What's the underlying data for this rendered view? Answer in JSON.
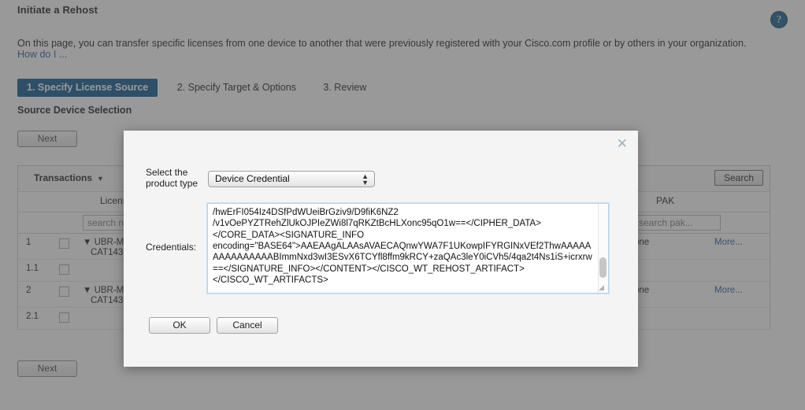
{
  "page": {
    "title": "Initiate a Rehost",
    "intro": "On this page, you can transfer specific licenses from one device to another that were previously registered with your Cisco.com profile or by others in your organization.",
    "how_do_i": "How do I ...",
    "help_icon": "question-mark-icon",
    "section_title": "Source Device Selection",
    "next_label": "Next",
    "steps": [
      {
        "label": "1. Specify License Source",
        "active": true
      },
      {
        "label": "2. Specify Target & Options",
        "active": false
      },
      {
        "label": "3. Review",
        "active": false
      }
    ]
  },
  "grid": {
    "transactions_label": "Transactions",
    "transactions_caret": "▼",
    "search_button": "Search",
    "columns": {
      "license": "License",
      "pak": "PAK"
    },
    "filters": {
      "license_placeholder": "search n",
      "pak_placeholder": "search pak..."
    },
    "rows": [
      {
        "num": "1",
        "device_line1": "▼ UBR-M(",
        "device_line2": "CAT143",
        "pak": "one",
        "more": "More..."
      },
      {
        "num": "1.1",
        "device_line1": "",
        "device_line2": "",
        "pak": "",
        "more": ""
      },
      {
        "num": "2",
        "device_line1": "▼ UBR-M(",
        "device_line2": "CAT143",
        "pak": "one",
        "more": "More..."
      },
      {
        "num": "2.1",
        "device_line1": "",
        "device_line2": "",
        "pak": "",
        "more": ""
      }
    ]
  },
  "modal": {
    "close_icon": "close-x-icon",
    "product_type_label": "Select the product type",
    "product_type_value": "Device Credential",
    "credentials_label": "Credentials:",
    "credentials_value": "/hwErFI054Iz4DSfPdWUeiBrGziv9/D9fiK6NZ2\n/v1vOePYZTRehZlUkOJPIeZWi8l7qRKZtBcHLXonc95qO1w==</CIPHER_DATA>\n</CORE_DATA><SIGNATURE_INFO\nencoding=\"BASE64\">AAEAAgALAAsAVAECAQnwYWA7F1UKowpIFYRGINxVEf2ThwAAAAAAAAAAAAAAABImmNxd3wI3ESvX6TCYfl8ffm9kRCY+zaQAc3leY0iCVh5/4qa2t4Ns1iS+icrxrw==</SIGNATURE_INFO></CONTENT></CISCO_WT_REHOST_ARTIFACT>\n</CISCO_WT_ARTIFACTS>",
    "ok_label": "OK",
    "cancel_label": "Cancel"
  },
  "colors": {
    "accent": "#1f6599",
    "link": "#3b6ea5",
    "help_badge": "#2a6c96",
    "overlay": "rgba(60,60,60,0.52)",
    "textarea_border": "#b9d3e8"
  }
}
